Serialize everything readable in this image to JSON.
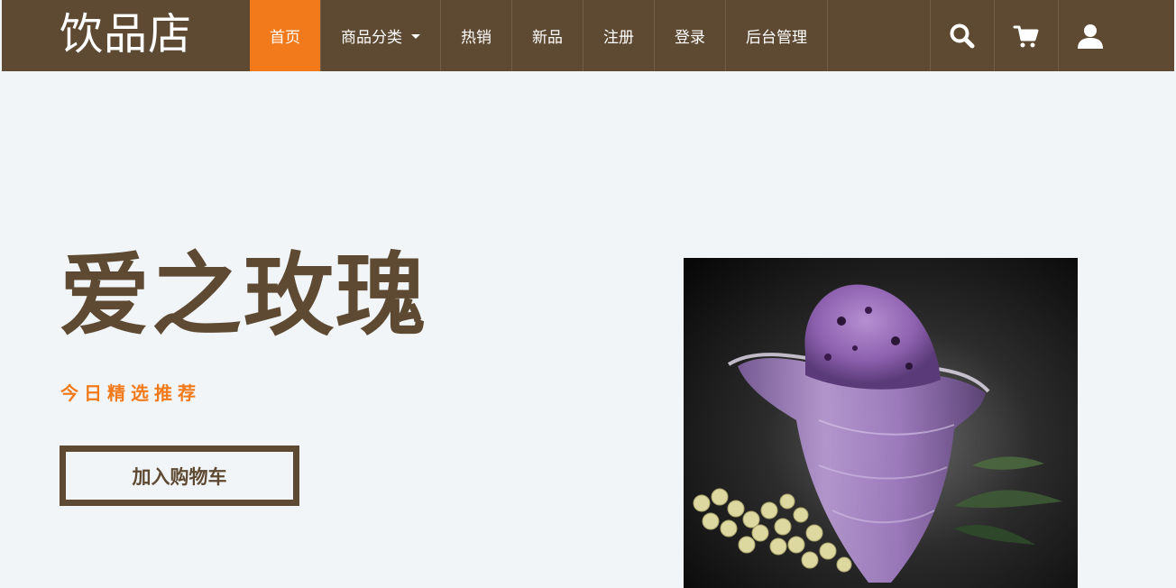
{
  "brand": {
    "name": "饮品店"
  },
  "nav": {
    "items": [
      {
        "label": "首页",
        "active": true
      },
      {
        "label": "商品分类",
        "dropdown": true
      },
      {
        "label": "热销"
      },
      {
        "label": "新品"
      },
      {
        "label": "注册"
      },
      {
        "label": "登录"
      },
      {
        "label": "后台管理"
      }
    ],
    "icons": [
      "search-icon",
      "cart-icon",
      "user-icon"
    ]
  },
  "hero": {
    "title": "爱之玫瑰",
    "subtitle": "今日精选推荐",
    "button_label": "加入购物车"
  },
  "colors": {
    "brand_brown": "#5e4a32",
    "accent_orange": "#f27a1a",
    "background": "#f2f5f7"
  }
}
